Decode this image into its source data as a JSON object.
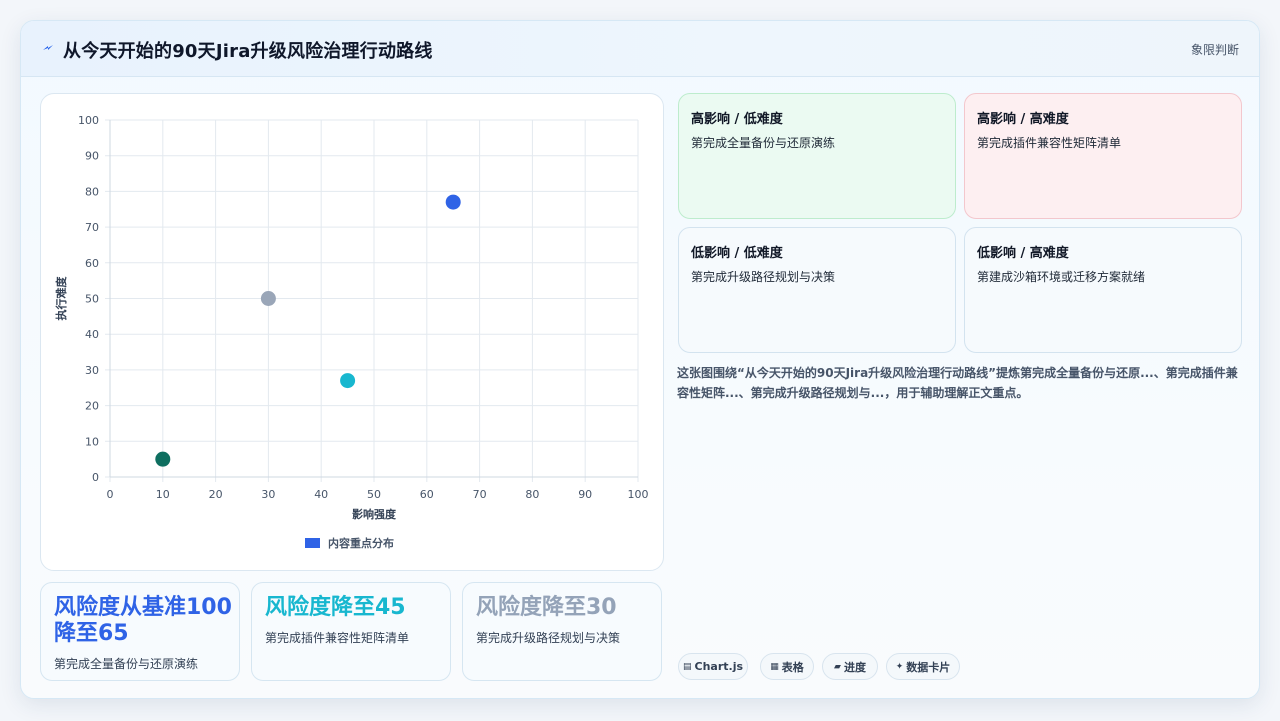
{
  "header": {
    "title": "从今天开始的90天Jira升级风险治理行动路线",
    "tag": "象限判断"
  },
  "chart_data": {
    "type": "scatter",
    "xlabel": "影响强度",
    "ylabel": "执行难度",
    "xlim": [
      0,
      100
    ],
    "ylim": [
      0,
      100
    ],
    "xticks": [
      "0",
      "10",
      "20",
      "30",
      "40",
      "50",
      "60",
      "70",
      "80",
      "90",
      "100"
    ],
    "yticks": [
      "0",
      "10",
      "20",
      "30",
      "40",
      "50",
      "60",
      "70",
      "80",
      "90",
      "100"
    ],
    "grid": true,
    "legend": {
      "position": "bottom",
      "label": "内容重点分布",
      "color": "#2f63e6"
    },
    "points": [
      {
        "x": 65,
        "y": 77,
        "color": "#2f63e6"
      },
      {
        "x": 30,
        "y": 50,
        "color": "#9aa6b8"
      },
      {
        "x": 45,
        "y": 27,
        "color": "#18b7cf"
      },
      {
        "x": 10,
        "y": 5,
        "color": "#0e6f60"
      }
    ]
  },
  "quadrants": [
    {
      "title": "高影响 / 低难度",
      "desc": "第完成全量备份与还原演练"
    },
    {
      "title": "高影响 / 高难度",
      "desc": "第完成插件兼容性矩阵清单"
    },
    {
      "title": "低影响 / 低难度",
      "desc": "第完成升级路径规划与决策"
    },
    {
      "title": "低影响 / 高难度",
      "desc": "第建成沙箱环境或迁移方案就绪"
    }
  ],
  "summary": "这张图围绕“从今天开始的90天Jira升级风险治理行动路线”提炼第完成全量备份与还原...、第完成插件兼容性矩阵...、第完成升级路径规划与...，用于辅助理解正文重点。",
  "stats": [
    {
      "value": "风险度从基准100降至65",
      "desc": "第完成全量备份与还原演练",
      "color": "#2f63e6"
    },
    {
      "value": "风险度降至45",
      "desc": "第完成插件兼容性矩阵清单",
      "color": "#18b7cf"
    },
    {
      "value": "风险度降至30",
      "desc": "第完成升级路径规划与决策",
      "color": "#94a3b8"
    }
  ],
  "pills": [
    {
      "icon": "▤",
      "label": "Chart.js"
    },
    {
      "icon": "▦",
      "label": "表格"
    },
    {
      "icon": "▰",
      "label": "进度"
    },
    {
      "icon": "✦",
      "label": "数据卡片"
    }
  ]
}
